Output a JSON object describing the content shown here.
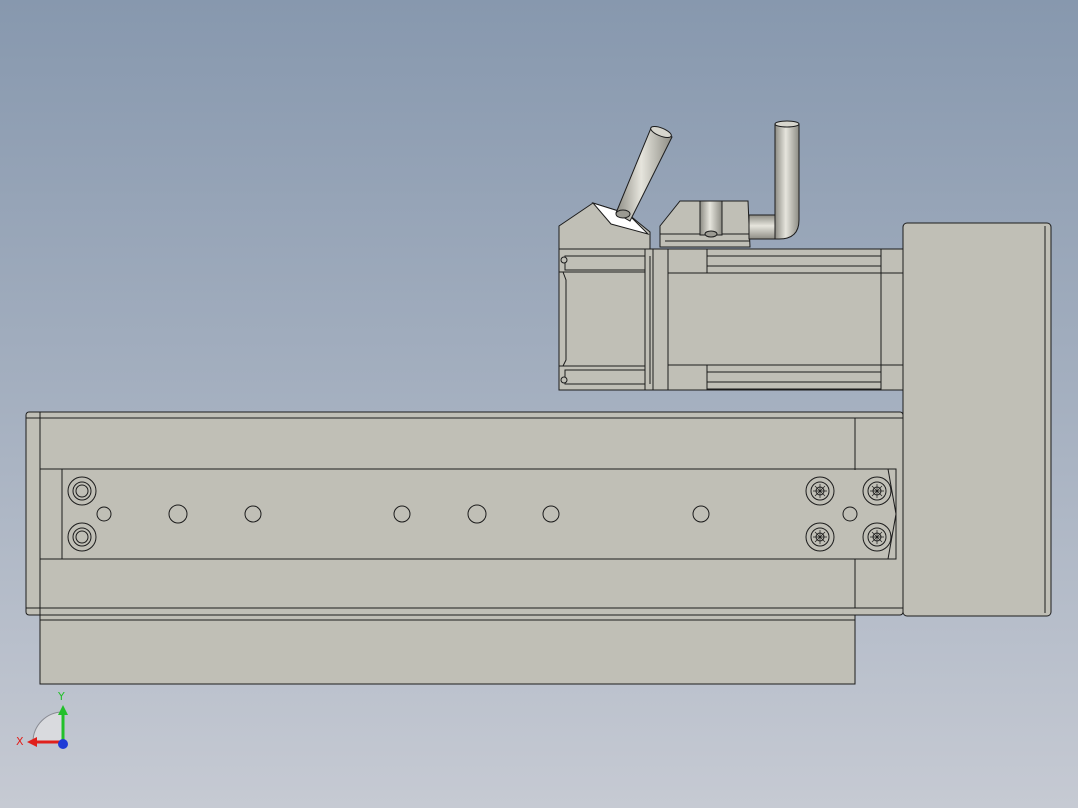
{
  "viewport": {
    "background_top": "#8798ae",
    "background_bottom": "#c6cad3",
    "part_fill": "#c0bfb6",
    "edge_color": "#1c1c1c"
  },
  "triad": {
    "x_label": "X",
    "y_label": "Y",
    "x_color": "#e0201c",
    "y_color": "#22c02a",
    "z_color": "#1f3bd6"
  }
}
